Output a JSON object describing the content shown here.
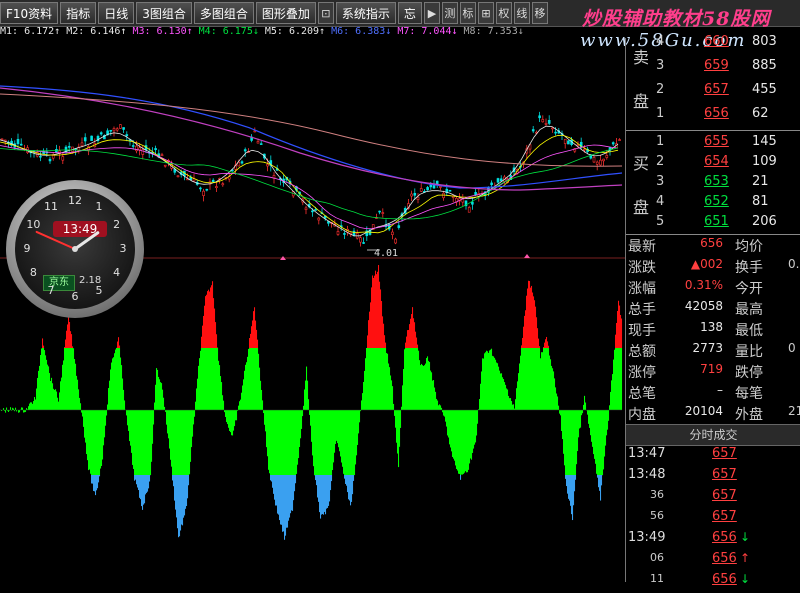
{
  "toolbar": {
    "buttons": [
      "F10资料",
      "指标",
      "日线",
      "3图组合",
      "多图组合",
      "图形叠加",
      "系统指示",
      "忘"
    ],
    "icon_buttons": [
      "▶",
      "测",
      "标",
      "⊞",
      "权",
      "线",
      "移"
    ]
  },
  "watermark": {
    "title": "炒股辅助教材58股网",
    "url": "www.58Gu.com"
  },
  "ma_row": [
    {
      "text": "M1: 6.172↑",
      "color": "#e8e8e8"
    },
    {
      "text": "M2: 6.146↑",
      "color": "#e8e8e8"
    },
    {
      "text": "M3: 6.130↑",
      "color": "#ff55ff"
    },
    {
      "text": "M4: 6.175↓",
      "color": "#00e040"
    },
    {
      "text": "M5: 6.209↑",
      "color": "#e8e8e8"
    },
    {
      "text": "M6: 6.383↓",
      "color": "#5070ff"
    },
    {
      "text": "M7: 7.044↓",
      "color": "#ff55ff"
    },
    {
      "text": "M8: 7.353↓",
      "color": "#aaaaaa"
    }
  ],
  "chart": {
    "low_label": "4.01"
  },
  "order_book": {
    "sell_label_top": "卖",
    "sell_label_bottom": "盘",
    "buy_label_top": "买",
    "buy_label_bottom": "盘",
    "sell": [
      {
        "n": "4",
        "price": "660",
        "vol": "803"
      },
      {
        "n": "3",
        "price": "659",
        "vol": "885"
      },
      {
        "n": "2",
        "price": "657",
        "vol": "455"
      },
      {
        "n": "1",
        "price": "656",
        "vol": "62"
      }
    ],
    "buy": [
      {
        "n": "1",
        "price": "655",
        "vol": "145"
      },
      {
        "n": "2",
        "price": "654",
        "vol": "109"
      },
      {
        "n": "3",
        "price": "653",
        "vol": "21"
      },
      {
        "n": "4",
        "price": "652",
        "vol": "81"
      },
      {
        "n": "5",
        "price": "651",
        "vol": "206"
      }
    ]
  },
  "quote": [
    {
      "l": "最新",
      "v": "656",
      "vc": "#ff4040",
      "l2": "均价",
      "v2": ""
    },
    {
      "l": "涨跌",
      "v": "▲002",
      "vc": "#ff4040",
      "l2": "换手",
      "v2": "0."
    },
    {
      "l": "涨幅",
      "v": "0.31%",
      "vc": "#ff4040",
      "l2": "今开",
      "v2": ""
    },
    {
      "l": "总手",
      "v": "42058",
      "vc": "#e8e8e8",
      "l2": "最高",
      "v2": ""
    },
    {
      "l": "现手",
      "v": "138",
      "vc": "#e8e8e8",
      "l2": "最低",
      "v2": ""
    },
    {
      "l": "总额",
      "v": "2773",
      "vc": "#e8e8e8",
      "l2": "量比",
      "v2": "0"
    },
    {
      "l": "涨停",
      "v": "719",
      "vc": "#ff4040",
      "l2": "跌停",
      "v2": ""
    },
    {
      "l": "总笔",
      "v": "–",
      "vc": "#e8e8e8",
      "l2": "每笔",
      "v2": ""
    },
    {
      "l": "内盘",
      "v": "20104",
      "vc": "#e8e8e8",
      "l2": "外盘",
      "v2": "21"
    }
  ],
  "ticks": {
    "header": "分时成交",
    "rows": [
      {
        "t": "13:47",
        "p": "657",
        "a": "",
        "ac": "#ff4040",
        "s": false
      },
      {
        "t": "13:48",
        "p": "657",
        "a": "",
        "ac": "#ff4040",
        "s": false
      },
      {
        "t": "36",
        "p": "657",
        "a": "",
        "ac": "#ff4040",
        "s": true
      },
      {
        "t": "56",
        "p": "657",
        "a": "",
        "ac": "#ff4040",
        "s": true
      },
      {
        "t": "13:49",
        "p": "656",
        "a": "↓",
        "ac": "#00e040",
        "s": false
      },
      {
        "t": "06",
        "p": "656",
        "a": "↑",
        "ac": "#ff4040",
        "s": true
      },
      {
        "t": "11",
        "p": "656",
        "a": "↓",
        "ac": "#00e040",
        "s": true
      }
    ]
  },
  "clock": {
    "time": "13:49",
    "city": "京东",
    "value": "2.18",
    "numbers": [
      "12",
      "1",
      "2",
      "3",
      "4",
      "5",
      "6",
      "7",
      "8",
      "9",
      "10",
      "11"
    ],
    "hour": 13,
    "minute": 49
  }
}
